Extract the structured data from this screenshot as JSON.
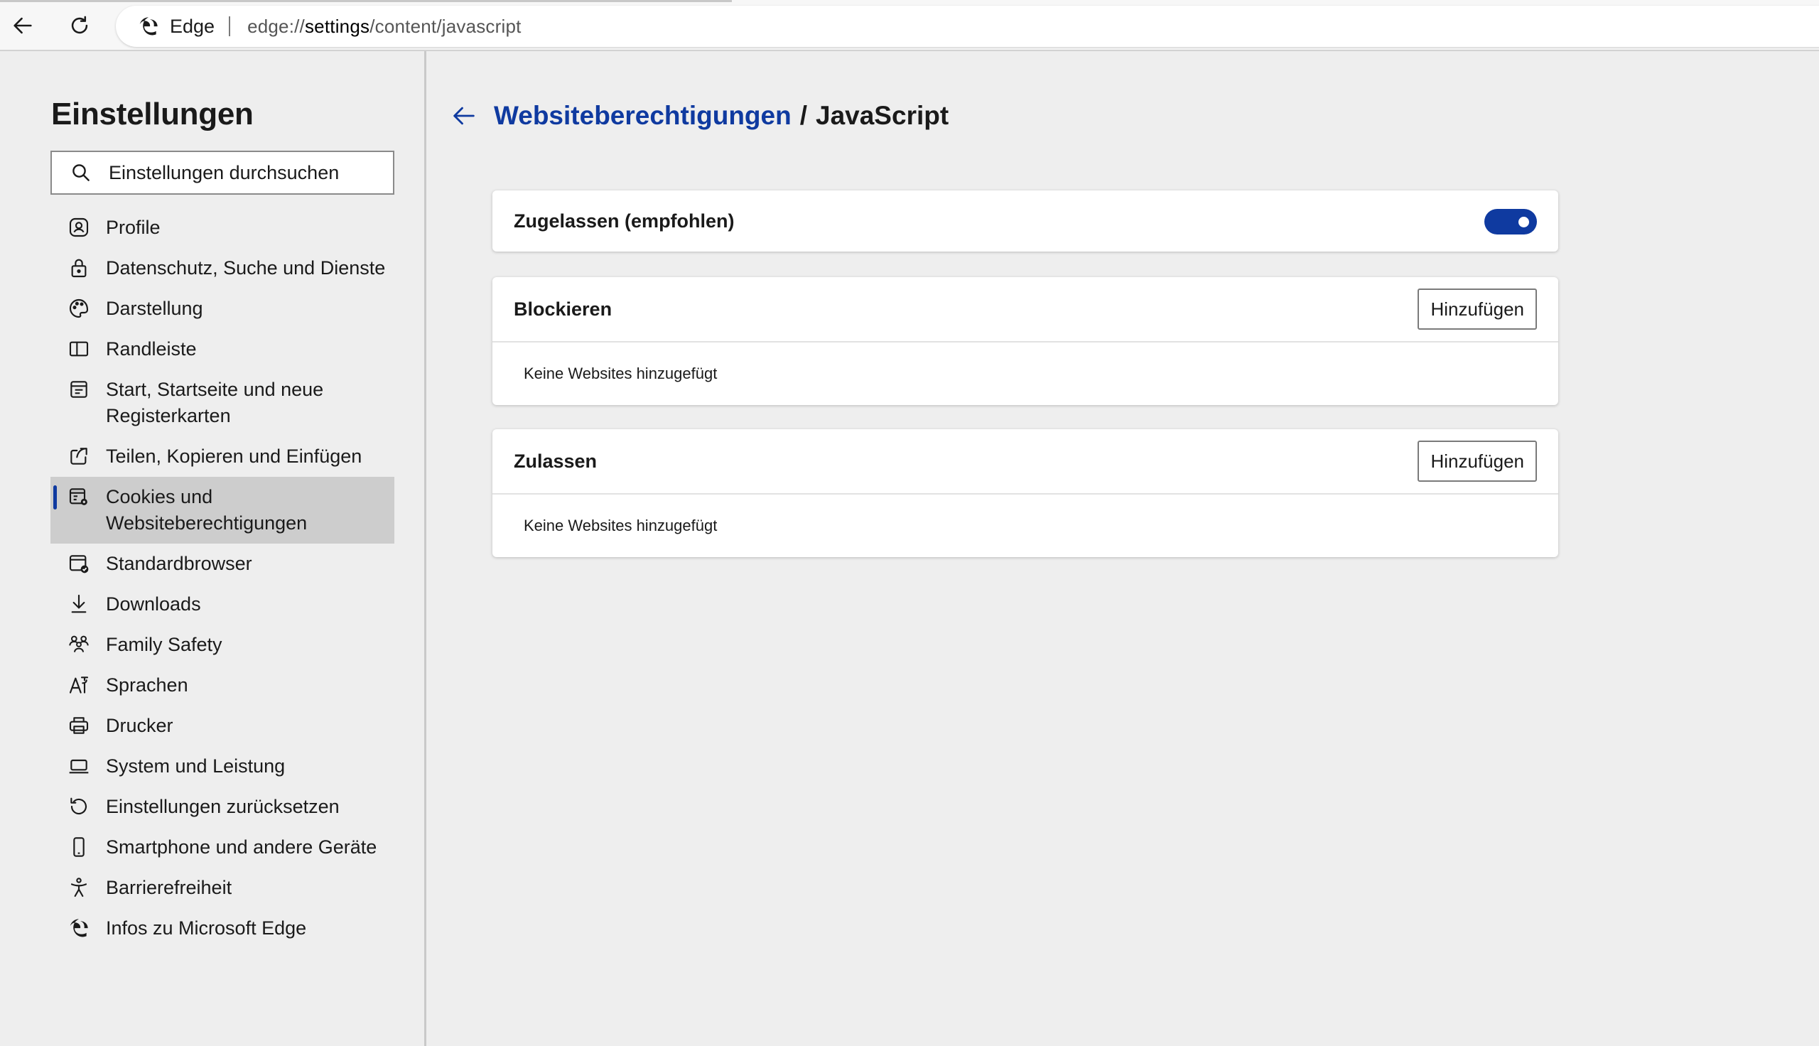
{
  "browser": {
    "brand": "Edge",
    "url_prefix": "edge://",
    "url_bold": "settings",
    "url_rest": "/content/javascript"
  },
  "sidebar": {
    "title": "Einstellungen",
    "search_placeholder": "Einstellungen durchsuchen",
    "items": [
      {
        "label": "Profile",
        "icon": "profile-icon"
      },
      {
        "label": "Datenschutz, Suche und Dienste",
        "icon": "lock-icon"
      },
      {
        "label": "Darstellung",
        "icon": "palette-icon"
      },
      {
        "label": "Randleiste",
        "icon": "sidebar-panel-icon"
      },
      {
        "label": "Start, Startseite und neue Registerkarten",
        "icon": "home-tab-icon"
      },
      {
        "label": "Teilen, Kopieren und Einfügen",
        "icon": "share-icon"
      },
      {
        "label": "Cookies und Websiteberechtigungen",
        "icon": "cookies-gear-icon",
        "active": true
      },
      {
        "label": "Standardbrowser",
        "icon": "default-browser-icon"
      },
      {
        "label": "Downloads",
        "icon": "download-icon"
      },
      {
        "label": "Family Safety",
        "icon": "family-icon"
      },
      {
        "label": "Sprachen",
        "icon": "language-icon"
      },
      {
        "label": "Drucker",
        "icon": "printer-icon"
      },
      {
        "label": "System und Leistung",
        "icon": "laptop-icon"
      },
      {
        "label": "Einstellungen zurücksetzen",
        "icon": "reset-icon"
      },
      {
        "label": "Smartphone und andere Geräte",
        "icon": "phone-icon"
      },
      {
        "label": "Barrierefreiheit",
        "icon": "accessibility-icon"
      },
      {
        "label": "Infos zu Microsoft Edge",
        "icon": "edge-logo-icon"
      }
    ]
  },
  "main": {
    "breadcrumb_parent": "Websiteberechtigungen",
    "breadcrumb_separator": "/",
    "breadcrumb_current": "JavaScript",
    "allowed_label": "Zugelassen (empfohlen)",
    "allowed_toggle_on": true,
    "block": {
      "title": "Blockieren",
      "add_label": "Hinzufügen",
      "empty_text": "Keine Websites hinzugefügt"
    },
    "permit": {
      "title": "Zulassen",
      "add_label": "Hinzufügen",
      "empty_text": "Keine Websites hinzugefügt"
    }
  },
  "colors": {
    "accent": "#0f3aa0",
    "active_item_bg": "#cdcdcd",
    "page_bg": "#eeeeee"
  }
}
